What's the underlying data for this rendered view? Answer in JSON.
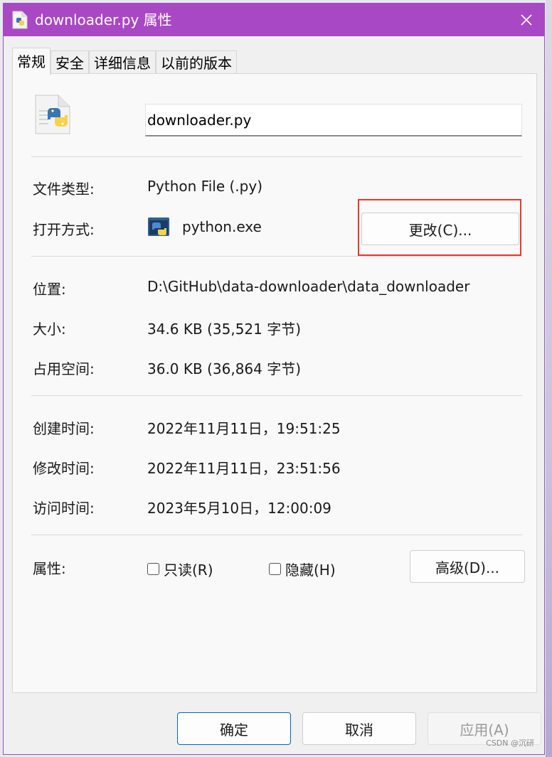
{
  "window": {
    "title": "downloader.py 属性",
    "close_icon": "close-icon"
  },
  "tabs": [
    {
      "label": "常规",
      "active": true
    },
    {
      "label": "安全",
      "active": false
    },
    {
      "label": "详细信息",
      "active": false
    },
    {
      "label": "以前的版本",
      "active": false
    }
  ],
  "general": {
    "file_name": "downloader.py",
    "file_type_label": "文件类型:",
    "file_type_value": "Python File (.py)",
    "open_with_label": "打开方式:",
    "open_with_value": "python.exe",
    "change_button": "更改(C)...",
    "location_label": "位置:",
    "location_value": "D:\\GitHub\\data-downloader\\data_downloader",
    "size_label": "大小:",
    "size_value": "34.6 KB (35,521 字节)",
    "size_on_disk_label": "占用空间:",
    "size_on_disk_value": "36.0 KB (36,864 字节)",
    "created_label": "创建时间:",
    "created_value": "2022年11月11日，19:51:25",
    "modified_label": "修改时间:",
    "modified_value": "2022年11月11日，23:51:56",
    "accessed_label": "访问时间:",
    "accessed_value": "2023年5月10日，12:00:09",
    "attributes_label": "属性:",
    "readonly_label": "只读(R)",
    "readonly_checked": false,
    "hidden_label": "隐藏(H)",
    "hidden_checked": false,
    "advanced_button": "高级(D)..."
  },
  "footer": {
    "ok": "确定",
    "cancel": "取消",
    "apply": "应用(A)"
  },
  "watermark": "CSDN @沉研",
  "colors": {
    "titlebar": "#a948c4",
    "highlight_box": "#e8382b",
    "primary_border": "#0067c0"
  }
}
